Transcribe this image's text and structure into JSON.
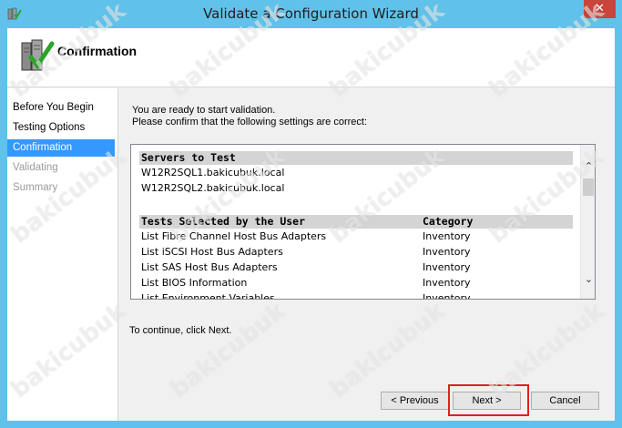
{
  "window": {
    "title": "Validate a Configuration Wizard",
    "close_glyph": "✕"
  },
  "header": {
    "page_title": "Confirmation"
  },
  "nav": {
    "items": [
      {
        "label": "Before You Begin",
        "state": "done"
      },
      {
        "label": "Testing Options",
        "state": "done"
      },
      {
        "label": "Confirmation",
        "state": "active"
      },
      {
        "label": "Validating",
        "state": "pending"
      },
      {
        "label": "Summary",
        "state": "pending"
      }
    ]
  },
  "content": {
    "intro_line1": "You are ready to start validation.",
    "intro_line2": "Please confirm that the following settings are correct:",
    "servers_heading": "Servers to Test",
    "servers": [
      "W12R2SQL1.bakicubuk.local",
      "W12R2SQL2.bakicubuk.local"
    ],
    "tests_heading": "Tests Selected by the User",
    "category_heading": "Category",
    "tests": [
      {
        "name": "List Fibre Channel Host Bus Adapters",
        "category": "Inventory"
      },
      {
        "name": "List iSCSI Host Bus Adapters",
        "category": "Inventory"
      },
      {
        "name": "List SAS Host Bus Adapters",
        "category": "Inventory"
      },
      {
        "name": "List BIOS Information",
        "category": "Inventory"
      },
      {
        "name": "List Environment Variables",
        "category": "Inventory"
      }
    ],
    "continue_text": "To continue, click Next."
  },
  "buttons": {
    "previous": "< Previous",
    "next": "Next >",
    "cancel": "Cancel"
  },
  "scrollbar": {
    "up_glyph": "⌃",
    "down_glyph": "⌄"
  },
  "watermark": "bakicubuk",
  "colors": {
    "titlebar": "#60c2ea",
    "close": "#c7453a",
    "selection": "#3399ff",
    "highlight_border": "#e02020"
  }
}
